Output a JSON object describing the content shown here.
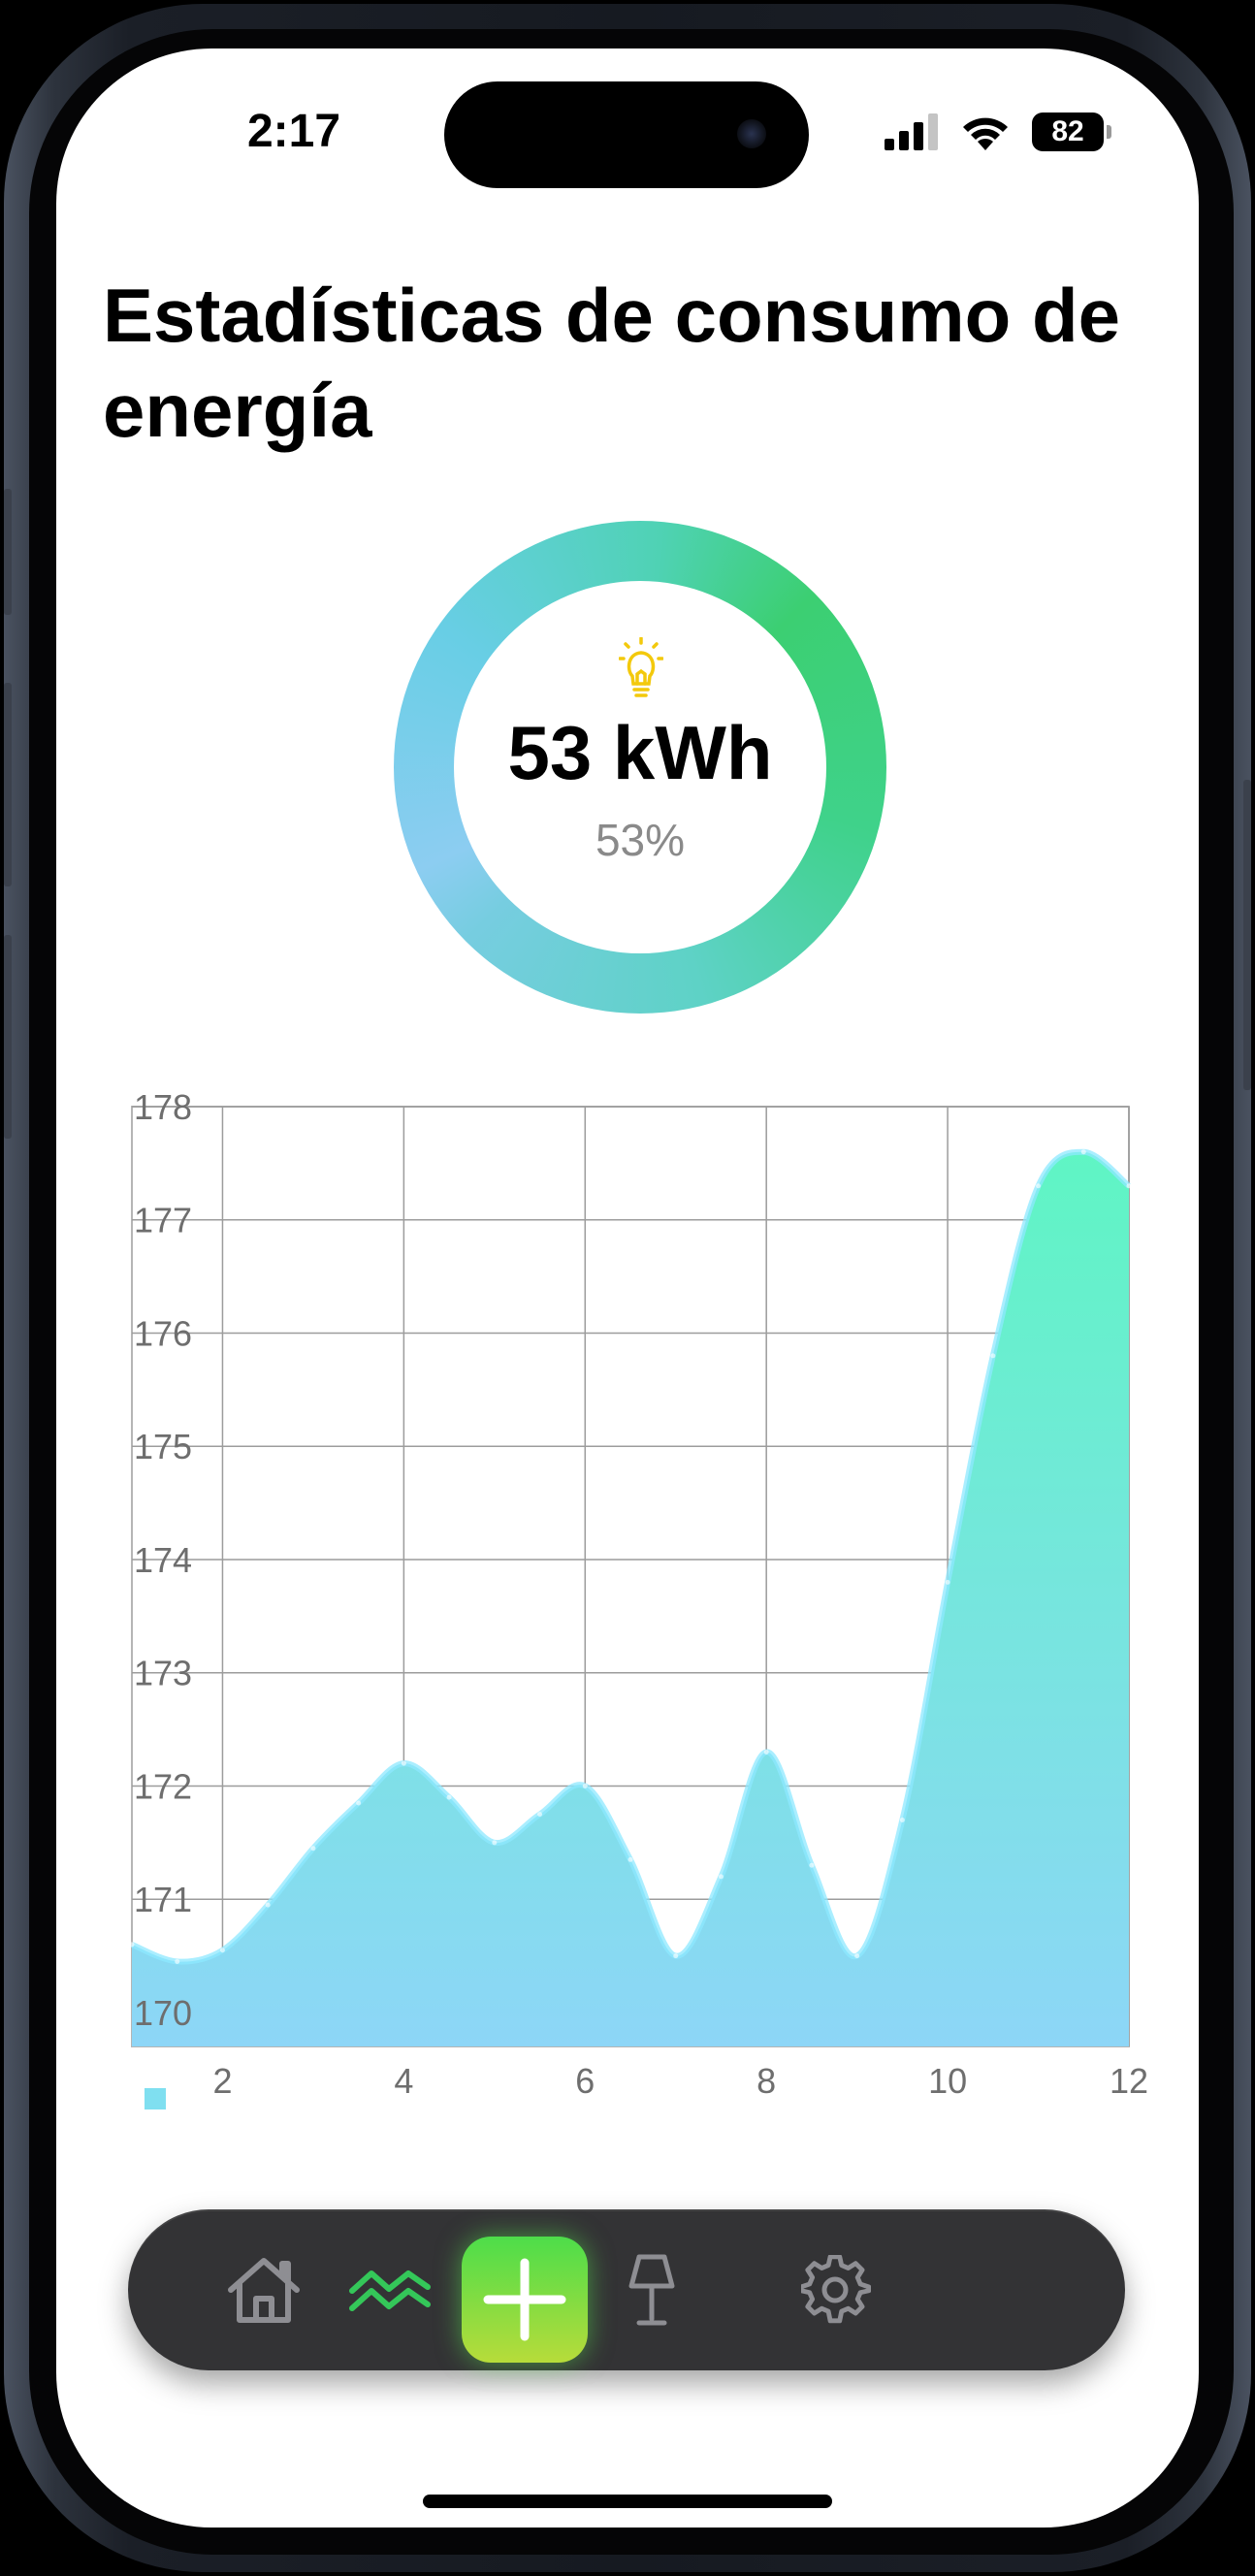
{
  "status_bar": {
    "time": "2:17",
    "battery": "82"
  },
  "page": {
    "title": "Estadísticas de consumo de energía"
  },
  "summary": {
    "icon": "lightbulb-icon",
    "value": "53 kWh",
    "percent_label": "53%",
    "percent": 53
  },
  "colors": {
    "ring_green": "#3ccf72",
    "ring_blue": "#8ccdf1",
    "area_top": "#5ff5c4",
    "area_bottom": "#8dd6f7",
    "tab_active": "#34c759",
    "tab_bar": "#333335"
  },
  "chart_data": {
    "type": "area",
    "x": [
      1.0,
      1.5,
      2.0,
      2.5,
      3.0,
      3.5,
      4.0,
      4.5,
      5.0,
      5.5,
      6.0,
      6.5,
      7.0,
      7.5,
      8.0,
      8.5,
      9.0,
      9.5,
      10.0,
      10.5,
      11.0,
      11.5,
      12.0
    ],
    "series": [
      {
        "values": [
          170.6,
          170.45,
          170.55,
          170.95,
          171.45,
          171.85,
          172.2,
          171.9,
          171.5,
          171.75,
          172.0,
          171.35,
          170.5,
          171.2,
          172.3,
          171.3,
          170.5,
          171.7,
          173.8,
          175.8,
          177.3,
          177.6,
          177.3
        ]
      }
    ],
    "xticks": [
      "2",
      "4",
      "6",
      "8",
      "10",
      "12"
    ],
    "yticks": [
      "170",
      "171",
      "172",
      "173",
      "174",
      "175",
      "176",
      "177",
      "178"
    ],
    "xlim": [
      1.0,
      12.0
    ],
    "ylim": [
      169.7,
      178.0
    ],
    "grid": true,
    "title": "",
    "xlabel": "",
    "ylabel": ""
  },
  "tab_bar": {
    "items": [
      {
        "name": "tab-home",
        "icon": "home-icon",
        "active": false
      },
      {
        "name": "tab-stats",
        "icon": "chart-wave-icon",
        "active": true
      },
      {
        "name": "tab-add",
        "icon": "plus-icon",
        "active": false
      },
      {
        "name": "tab-lamp",
        "icon": "lamp-icon",
        "active": false
      },
      {
        "name": "tab-settings",
        "icon": "gear-icon",
        "active": false
      }
    ]
  }
}
